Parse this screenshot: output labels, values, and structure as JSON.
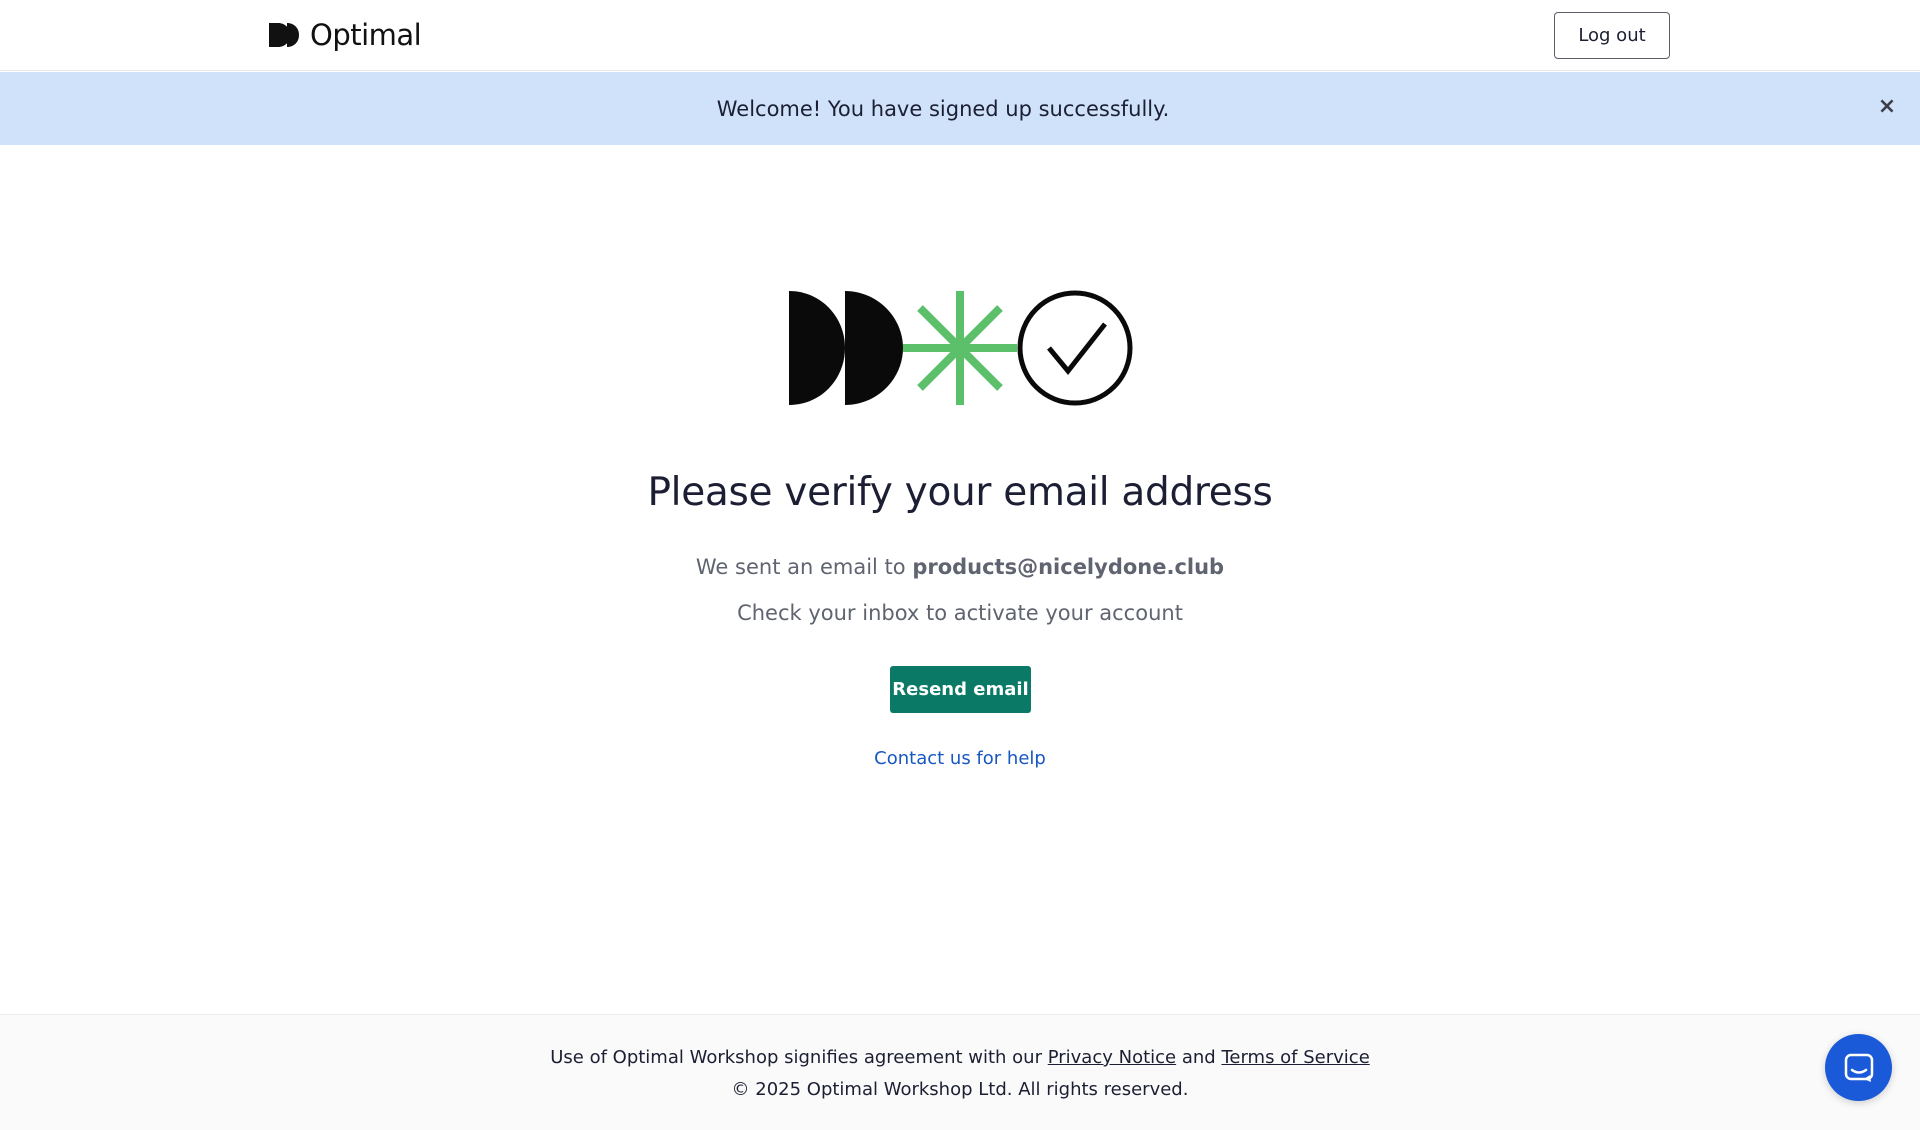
{
  "header": {
    "brand": "Optimal",
    "logout_label": "Log out"
  },
  "flash": {
    "message": "Welcome! You have signed up successfully.",
    "close_glyph": "×"
  },
  "main": {
    "title": "Please verify your email address",
    "sent_prefix": "We sent an email to ",
    "email": "products@nicelydone.club",
    "check_inbox": "Check your inbox to activate your account",
    "resend_label": "Resend email",
    "help_link": "Contact us for help"
  },
  "footer": {
    "agreement_prefix": "Use of Optimal Workshop signifies agreement with our ",
    "privacy_link": "Privacy Notice",
    "and_text": " and ",
    "terms_link": "Terms of Service",
    "copyright": "© 2025 Optimal Workshop Ltd. All rights reserved."
  },
  "icons": {
    "logo": "optimal-logo-icon",
    "illustration": "verify-illustration",
    "close": "close-icon",
    "chat": "chat-icon"
  },
  "colors": {
    "banner": "#cfe2f9",
    "primary_button": "#0a7a66",
    "link": "#1757c2",
    "asterisk": "#5cc06a",
    "chat_button": "#1a5ad8"
  }
}
